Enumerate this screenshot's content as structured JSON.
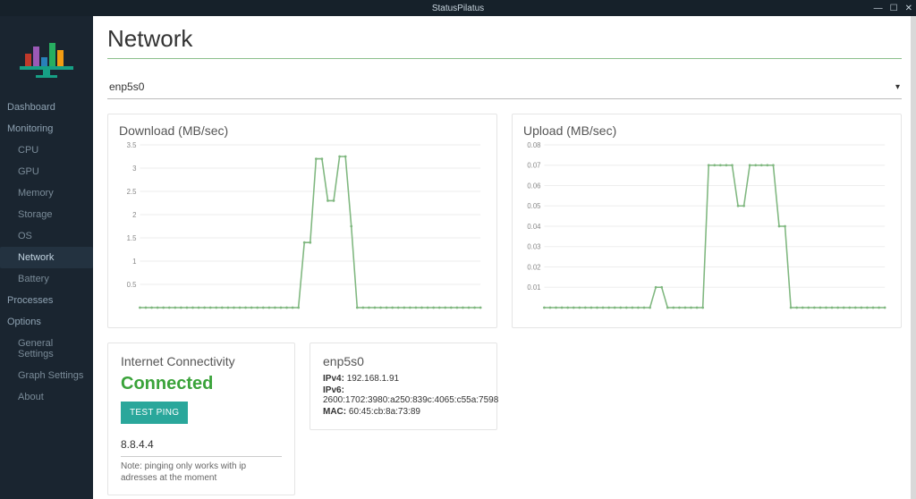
{
  "window": {
    "title": "StatusPilatus"
  },
  "sidebar": {
    "items": [
      {
        "label": "Dashboard",
        "type": "top"
      },
      {
        "label": "Monitoring",
        "type": "top"
      },
      {
        "label": "CPU",
        "type": "sub"
      },
      {
        "label": "GPU",
        "type": "sub"
      },
      {
        "label": "Memory",
        "type": "sub"
      },
      {
        "label": "Storage",
        "type": "sub"
      },
      {
        "label": "OS",
        "type": "sub"
      },
      {
        "label": "Network",
        "type": "sub",
        "active": true
      },
      {
        "label": "Battery",
        "type": "sub"
      },
      {
        "label": "Processes",
        "type": "top"
      },
      {
        "label": "Options",
        "type": "top"
      },
      {
        "label": "General Settings",
        "type": "sub"
      },
      {
        "label": "Graph Settings",
        "type": "sub"
      },
      {
        "label": "About",
        "type": "sub"
      }
    ]
  },
  "page": {
    "title": "Network",
    "interface_selected": "enp5s0"
  },
  "charts": {
    "download": {
      "title": "Download (MB/sec)"
    },
    "upload": {
      "title": "Upload (MB/sec)"
    }
  },
  "connectivity": {
    "title": "Internet Connectivity",
    "status": "Connected",
    "button": "TEST PING",
    "ping_target": "8.8.4.4",
    "note": "Note: pinging only works with ip adresses at the moment"
  },
  "interface_info": {
    "name": "enp5s0",
    "ipv4_label": "IPv4:",
    "ipv4": "192.168.1.91",
    "ipv6_label": "IPv6:",
    "ipv6": "2600:1702:3980:a250:839c:4065:c55a:7598",
    "mac_label": "MAC:",
    "mac": "60:45:cb:8a:73:89"
  },
  "chart_data": [
    {
      "type": "line",
      "title": "Download (MB/sec)",
      "xlabel": "",
      "ylabel": "",
      "ylim": [
        0,
        3.5
      ],
      "yticks": [
        0.5,
        1.0,
        1.5,
        2.0,
        2.5,
        3.0,
        3.5
      ],
      "x": [
        0,
        1,
        2,
        3,
        4,
        5,
        6,
        7,
        8,
        9,
        10,
        11,
        12,
        13,
        14,
        15,
        16,
        17,
        18,
        19,
        20,
        21,
        22,
        23,
        24,
        25,
        26,
        27,
        28,
        29,
        30,
        31,
        32,
        33,
        34,
        35,
        36,
        37,
        38,
        39,
        40,
        41,
        42,
        43,
        44,
        45,
        46,
        47,
        48,
        49,
        50,
        51,
        52,
        53,
        54,
        55,
        56,
        57,
        58
      ],
      "values": [
        0,
        0,
        0,
        0,
        0,
        0,
        0,
        0,
        0,
        0,
        0,
        0,
        0,
        0,
        0,
        0,
        0,
        0,
        0,
        0,
        0,
        0,
        0,
        0,
        0,
        0,
        0,
        0,
        1.4,
        1.4,
        3.2,
        3.2,
        2.3,
        2.3,
        3.25,
        3.25,
        1.75,
        0,
        0,
        0,
        0,
        0,
        0,
        0,
        0,
        0,
        0,
        0,
        0,
        0,
        0,
        0,
        0,
        0,
        0,
        0,
        0,
        0,
        0
      ]
    },
    {
      "type": "line",
      "title": "Upload (MB/sec)",
      "xlabel": "",
      "ylabel": "",
      "ylim": [
        0,
        0.08
      ],
      "yticks": [
        0.01,
        0.02,
        0.03,
        0.04,
        0.05,
        0.06,
        0.07,
        0.08
      ],
      "x": [
        0,
        1,
        2,
        3,
        4,
        5,
        6,
        7,
        8,
        9,
        10,
        11,
        12,
        13,
        14,
        15,
        16,
        17,
        18,
        19,
        20,
        21,
        22,
        23,
        24,
        25,
        26,
        27,
        28,
        29,
        30,
        31,
        32,
        33,
        34,
        35,
        36,
        37,
        38,
        39,
        40,
        41,
        42,
        43,
        44,
        45,
        46,
        47,
        48,
        49,
        50,
        51,
        52,
        53,
        54,
        55,
        56,
        57,
        58
      ],
      "values": [
        0,
        0,
        0,
        0,
        0,
        0,
        0,
        0,
        0,
        0,
        0,
        0,
        0,
        0,
        0,
        0,
        0,
        0,
        0,
        0.01,
        0.01,
        0,
        0,
        0,
        0,
        0,
        0,
        0,
        0.07,
        0.07,
        0.07,
        0.07,
        0.07,
        0.05,
        0.05,
        0.07,
        0.07,
        0.07,
        0.07,
        0.07,
        0.04,
        0.04,
        0,
        0,
        0,
        0,
        0,
        0,
        0,
        0,
        0,
        0,
        0,
        0,
        0,
        0,
        0,
        0,
        0
      ]
    }
  ]
}
